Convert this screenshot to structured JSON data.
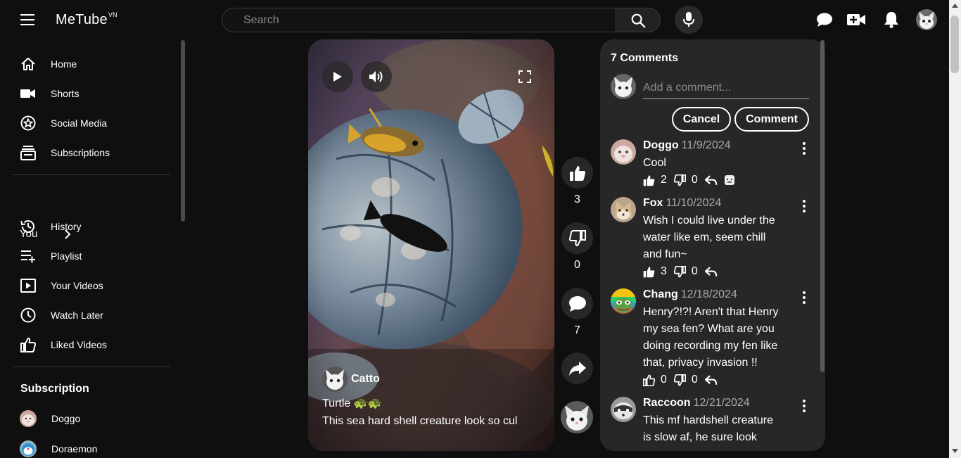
{
  "app": {
    "logo": "MeTube",
    "logo_sup": "VN"
  },
  "search": {
    "placeholder": "Search"
  },
  "sidebar": {
    "main_items": [
      {
        "label": "Home",
        "icon": "home-icon"
      },
      {
        "label": "Shorts",
        "icon": "shorts-icon"
      },
      {
        "label": "Social Media",
        "icon": "star-icon"
      },
      {
        "label": "Subscriptions",
        "icon": "subscriptions-icon"
      }
    ],
    "you_label": "You",
    "you_items": [
      {
        "label": "History",
        "icon": "history-icon"
      },
      {
        "label": "Playlist",
        "icon": "playlist-icon"
      },
      {
        "label": "Your Videos",
        "icon": "your-videos-icon"
      },
      {
        "label": "Watch Later",
        "icon": "clock-icon"
      },
      {
        "label": "Liked Videos",
        "icon": "thumbs-up-icon"
      }
    ],
    "subscription_heading": "Subscription",
    "subscriptions": [
      {
        "name": "Doggo"
      },
      {
        "name": "Doraemon"
      }
    ]
  },
  "video": {
    "channel": "Catto",
    "title": "Turtle 🐢🐢",
    "description": "This sea hard shell creature look so cul"
  },
  "actions": {
    "likes": "3",
    "dislikes": "0",
    "comments": "7"
  },
  "comments_panel": {
    "title": "7 Comments",
    "placeholder": "Add a comment...",
    "cancel_label": "Cancel",
    "comment_label": "Comment",
    "comments": [
      {
        "name": "Doggo",
        "date": "11/9/2024",
        "text": "Cool",
        "likes": "2",
        "dislikes": "0"
      },
      {
        "name": "Fox",
        "date": "11/10/2024",
        "text": "Wish I could live under the water like em, seem chill and fun~",
        "likes": "3",
        "dislikes": "0"
      },
      {
        "name": "Chang",
        "date": "12/18/2024",
        "text": "Henry?!?! Aren't that Henry my sea fen? What are you doing recording my fen like that, privacy invasion !!",
        "likes": "0",
        "dislikes": "0"
      },
      {
        "name": "Raccoon",
        "date": "12/21/2024",
        "text": "This mf hardshell creature is slow af, he sure look",
        "likes": "",
        "dislikes": ""
      }
    ]
  }
}
